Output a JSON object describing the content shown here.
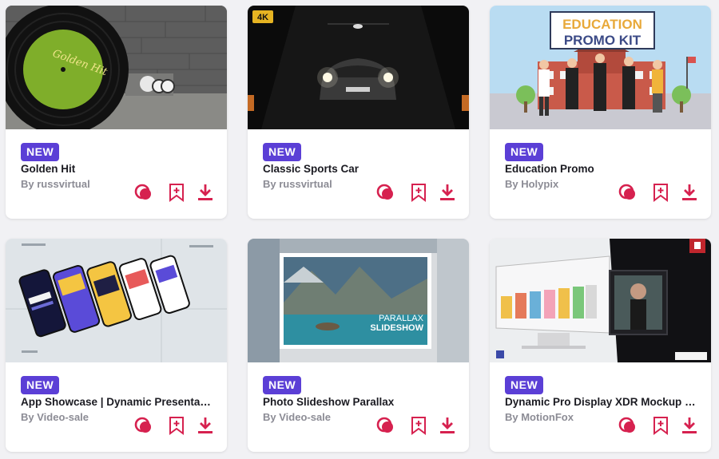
{
  "theme": {
    "accent": "#d6214f",
    "badge_bg": "#5b3fd6",
    "card_bg": "#ffffff",
    "page_bg": "#f1f1f4"
  },
  "cards": [
    {
      "badge": "NEW",
      "title": "Golden Hit",
      "author": "By russvirtual",
      "record_text": "Golden Hit",
      "icons": [
        "preview-icon",
        "bookmark-add-icon",
        "download-icon"
      ]
    },
    {
      "badge": "NEW",
      "title": "Classic Sports Car",
      "author": "By russvirtual",
      "quality_badge": "4K",
      "icons": [
        "preview-icon",
        "bookmark-add-icon",
        "download-icon"
      ]
    },
    {
      "badge": "NEW",
      "title": "Education Promo",
      "author": "By Holypix",
      "banner_line1": "EDUCATION",
      "banner_line2": "PROMO KIT",
      "icons": [
        "preview-icon",
        "bookmark-add-icon",
        "download-icon"
      ]
    },
    {
      "badge": "NEW",
      "title": "App Showcase | Dynamic Presentati...",
      "author": "By Video-sale",
      "icons": [
        "preview-icon",
        "bookmark-add-icon",
        "download-icon"
      ]
    },
    {
      "badge": "NEW",
      "title": "Photo Slideshow Parallax",
      "author": "By Video-sale",
      "overlay_line1": "PARALLAX",
      "overlay_line2": "SLIDESHOW",
      "icons": [
        "preview-icon",
        "bookmark-add-icon",
        "download-icon"
      ]
    },
    {
      "badge": "NEW",
      "title": "Dynamic Pro Display XDR Mockup |...",
      "author": "By MotionFox",
      "icons": [
        "preview-icon",
        "bookmark-add-icon",
        "download-icon"
      ]
    }
  ]
}
